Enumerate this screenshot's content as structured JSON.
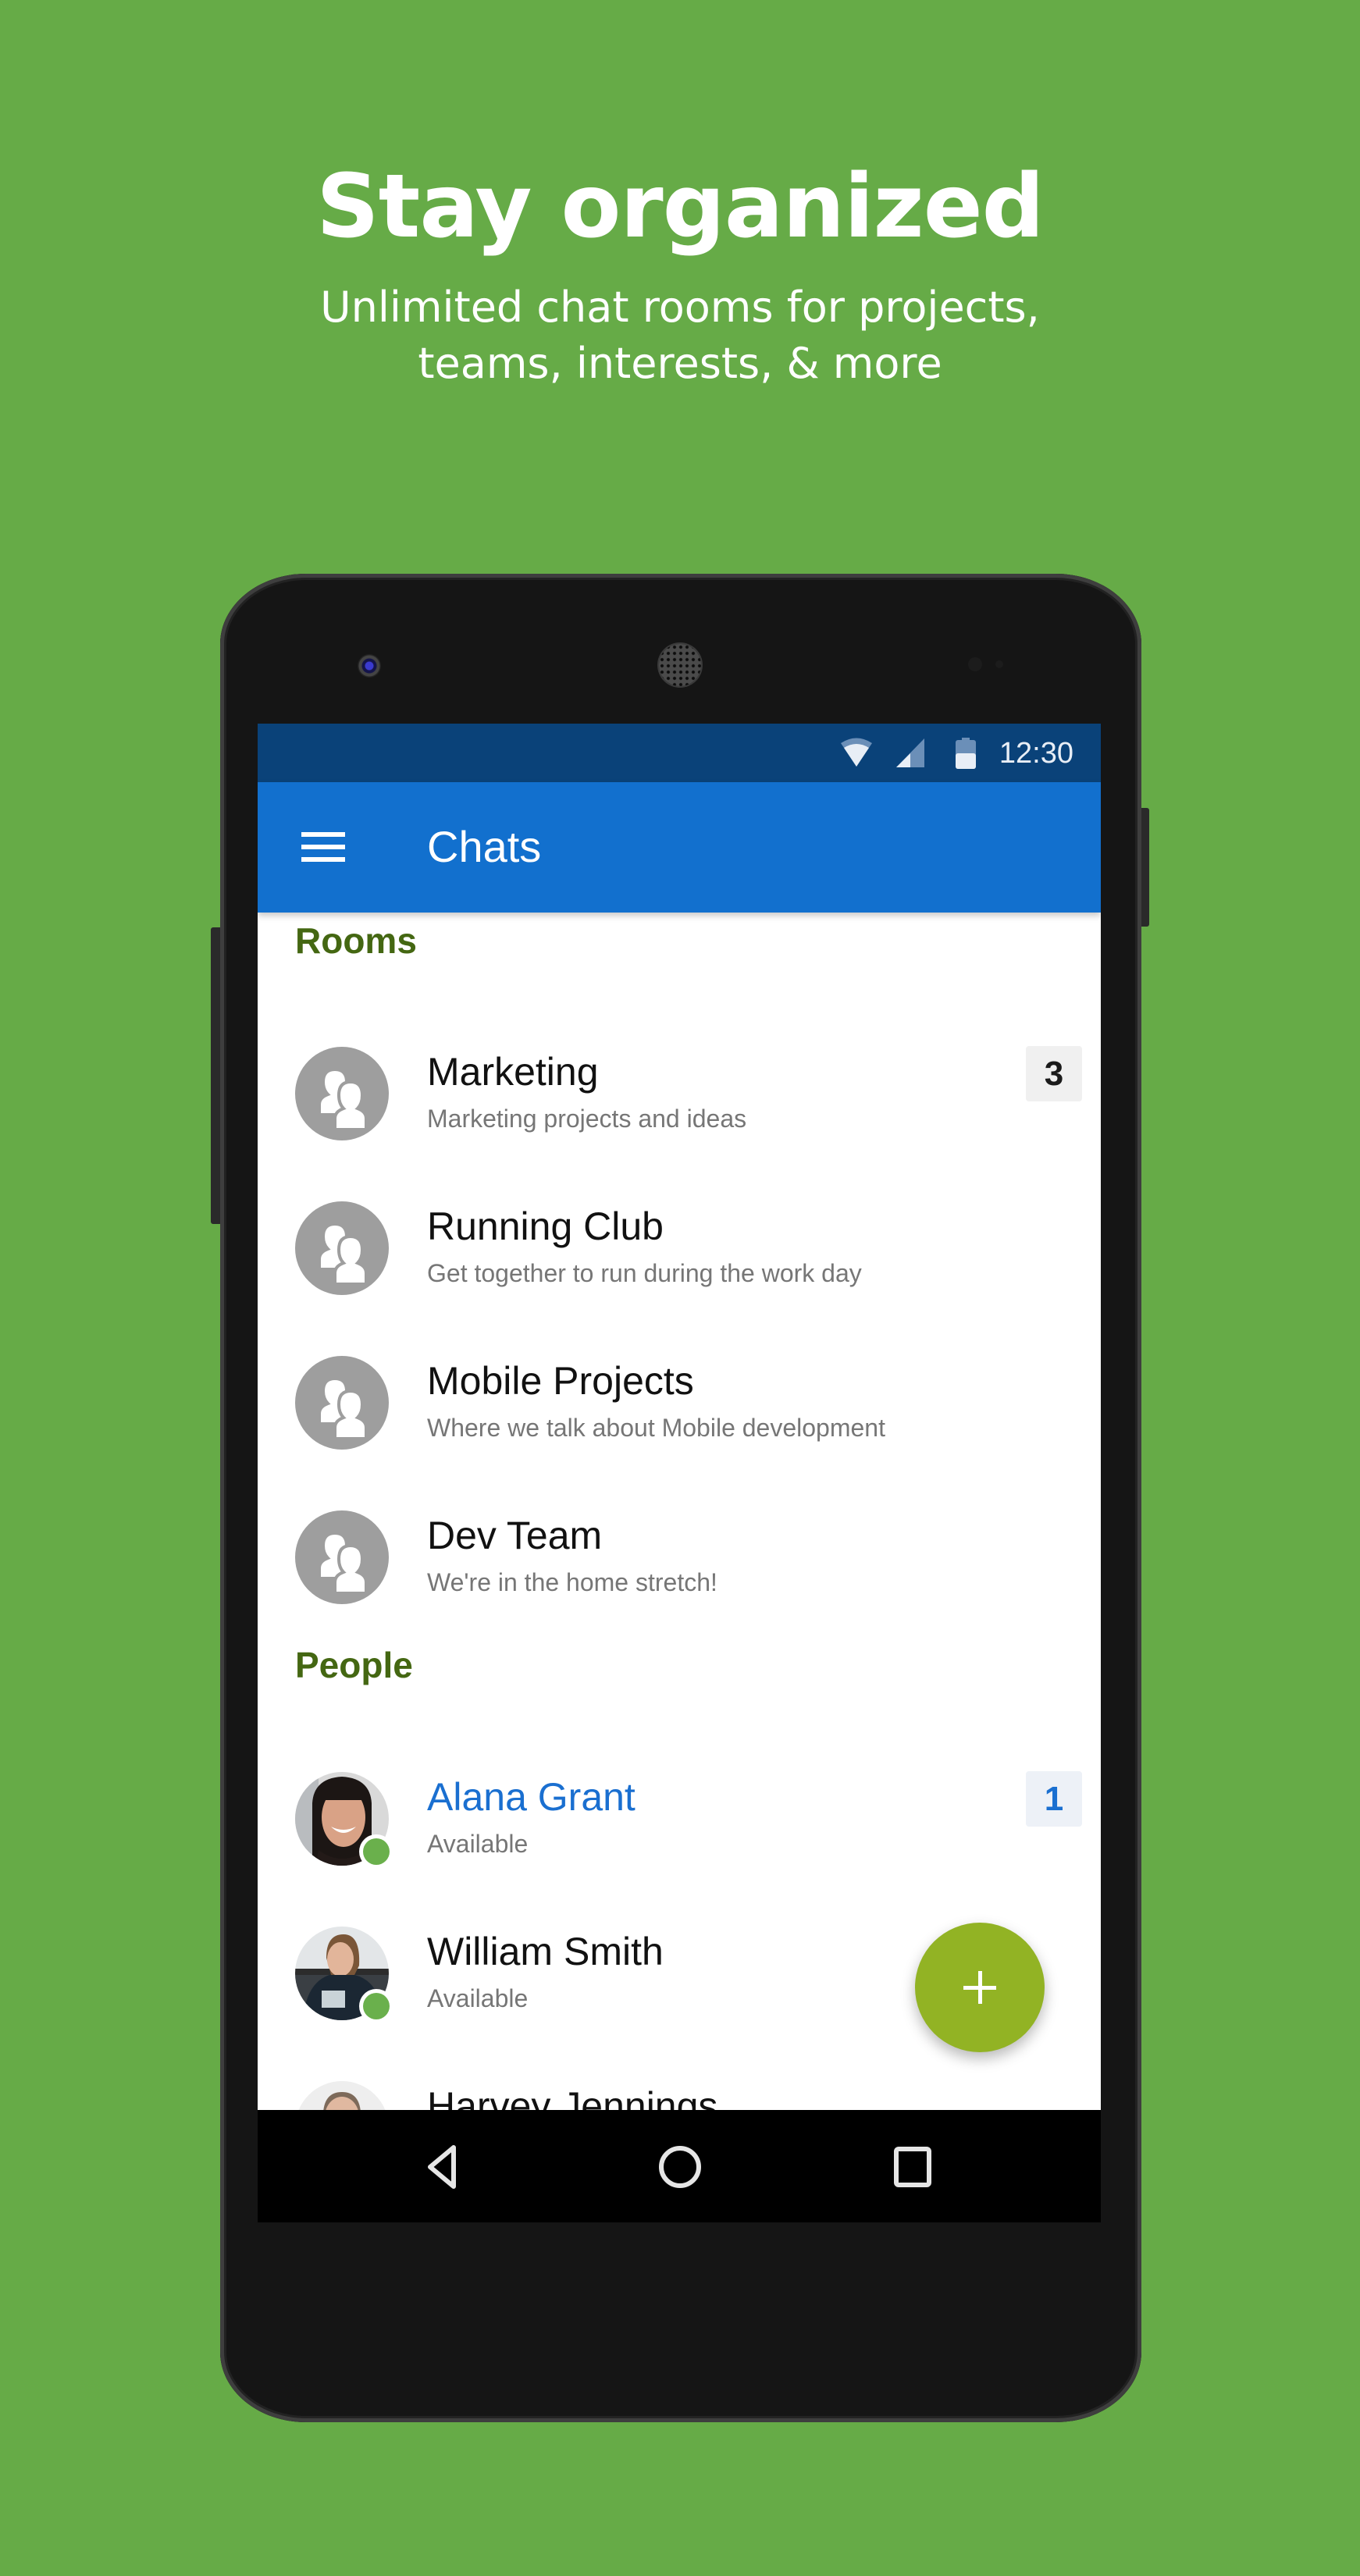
{
  "hero": {
    "title": "Stay organized",
    "subtitle_line1": "Unlimited chat rooms for projects,",
    "subtitle_line2": "teams, interests, & more"
  },
  "status_bar": {
    "time": "12:30",
    "icons": [
      "wifi-icon",
      "cell-signal-icon",
      "battery-icon"
    ]
  },
  "app_bar": {
    "menu_icon": "hamburger-menu-icon",
    "title": "Chats"
  },
  "sections": {
    "rooms": {
      "label": "Rooms",
      "items": [
        {
          "name": "Marketing",
          "description": "Marketing projects and ideas",
          "unread": "3"
        },
        {
          "name": "Running Club",
          "description": "Get together to run during the work day"
        },
        {
          "name": "Mobile Projects",
          "description": "Where we talk about Mobile development"
        },
        {
          "name": "Dev Team",
          "description": "We're in the home stretch!"
        }
      ]
    },
    "people": {
      "label": "People",
      "items": [
        {
          "name": "Alana Grant",
          "status": "Available",
          "unread": "1",
          "highlighted": true
        },
        {
          "name": "William Smith",
          "status": "Available"
        },
        {
          "name": "Harvey Jennings"
        }
      ]
    }
  },
  "fab": {
    "icon": "plus-icon",
    "action": "new-chat"
  },
  "nav_bar": {
    "buttons": [
      "back",
      "home",
      "recents"
    ]
  },
  "colors": {
    "background": "#66ab47",
    "status_bar": "#0a4279",
    "app_bar": "#1270ce",
    "section_header": "#446712",
    "highlight_name": "#1a6fd0",
    "presence_available": "#6ab04c",
    "fab": "#92b324"
  }
}
